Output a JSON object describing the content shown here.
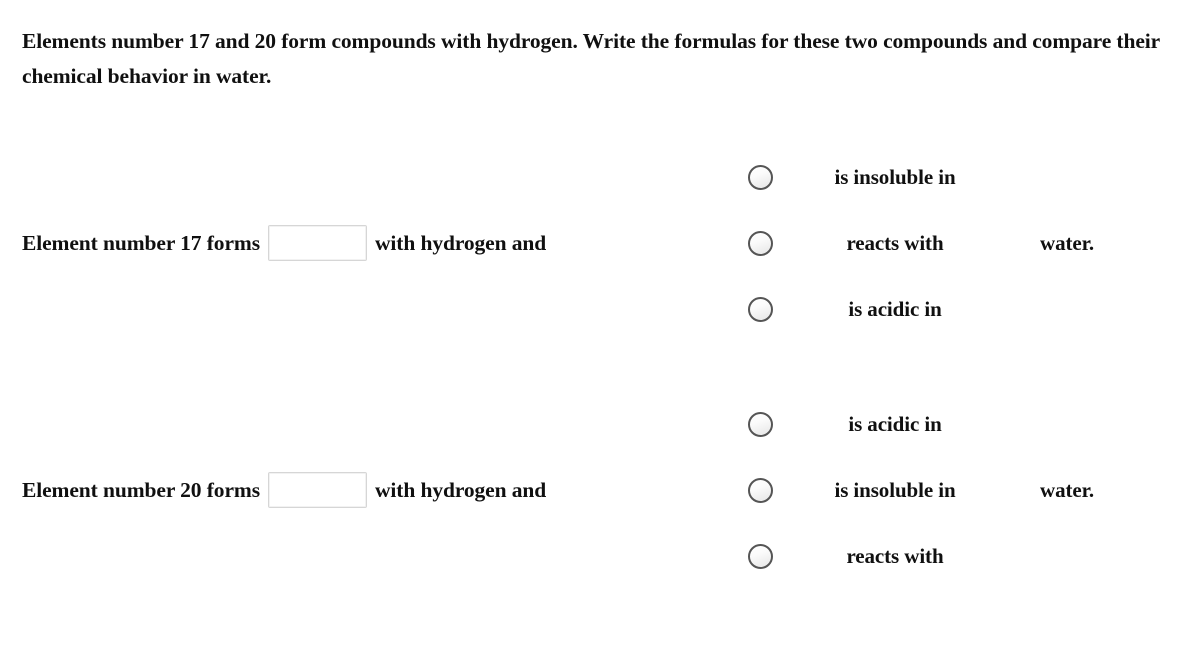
{
  "prompt": {
    "text": "Elements number 17 and 20 form compounds with hydrogen. Write the formulas for these two compounds and compare their chemical behavior in water."
  },
  "blocks": [
    {
      "stem_prefix": "Element number 17 forms",
      "input": {
        "value": "",
        "placeholder": ""
      },
      "stem_suffix": "with hydrogen and",
      "options": [
        {
          "label": "is insoluble in",
          "selected": false
        },
        {
          "label": "reacts with",
          "selected": false
        },
        {
          "label": "is acidic in",
          "selected": false
        }
      ],
      "trailing": "water."
    },
    {
      "stem_prefix": "Element number 20 forms",
      "input": {
        "value": "",
        "placeholder": ""
      },
      "stem_suffix": "with hydrogen and",
      "options": [
        {
          "label": "is acidic in",
          "selected": false
        },
        {
          "label": "is insoluble in",
          "selected": false
        },
        {
          "label": "reacts with",
          "selected": false
        }
      ],
      "trailing": "water."
    }
  ],
  "colors": {
    "page_background": "#ffffff",
    "text": "#101010",
    "radio_border": "#555555",
    "input_border": "#d6d6d6",
    "inner_box_border": "#c9c9c9"
  }
}
